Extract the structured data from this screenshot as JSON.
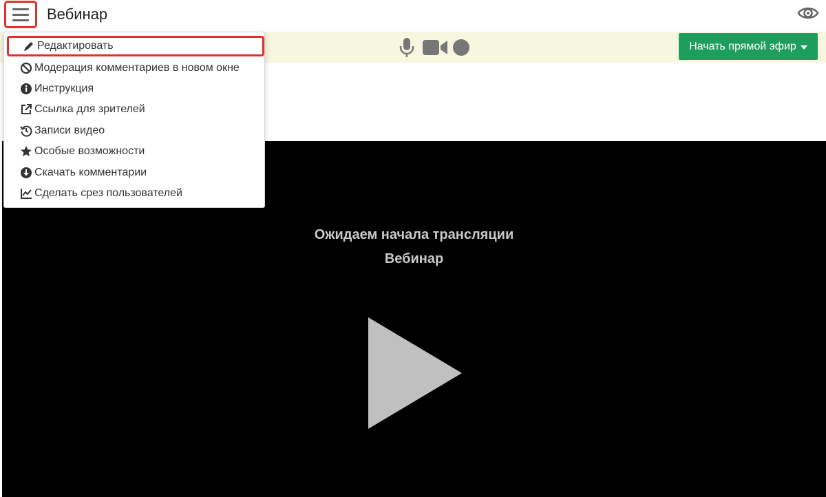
{
  "header": {
    "title": "Вебинар",
    "menu_icon": "hamburger-icon",
    "view_icon": "eye-icon"
  },
  "toolbar": {
    "icons": [
      "microphone-icon",
      "video-camera-icon",
      "record-icon"
    ],
    "live_button_label": "Начать прямой эфир"
  },
  "menu": {
    "items": [
      {
        "label": "Редактировать",
        "icon": "pencil-icon",
        "highlighted": true
      },
      {
        "label": "Модерация комментариев в новом окне",
        "icon": "ban-icon"
      },
      {
        "label": "Инструкция",
        "icon": "info-icon"
      },
      {
        "label": "Ссылка для зрителей",
        "icon": "external-link-icon"
      },
      {
        "label": "Записи видео",
        "icon": "history-icon"
      },
      {
        "label": "Особые возможности",
        "icon": "star-icon"
      },
      {
        "label": "Скачать комментарии",
        "icon": "download-icon"
      },
      {
        "label": "Сделать срез пользователей",
        "icon": "line-chart-icon"
      }
    ]
  },
  "video": {
    "status": "Ожидаем начала трансляции",
    "title": "Вебинар"
  },
  "colors": {
    "highlight": "#e0302b",
    "live_button": "#1e9e5c",
    "toolbar_bg": "#f6f7de",
    "video_bg": "#000000"
  }
}
